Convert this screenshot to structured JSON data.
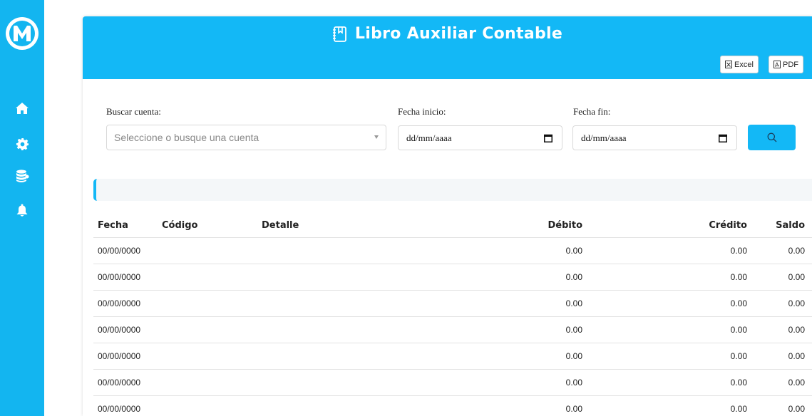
{
  "sidebar": {
    "items": [
      {
        "icon": "home-icon"
      },
      {
        "icon": "gear-icon"
      },
      {
        "icon": "coins-icon"
      },
      {
        "icon": "bell-icon"
      }
    ]
  },
  "header": {
    "title": "Libro Auxiliar Contable",
    "icon": "book-icon",
    "excel_label": "Excel",
    "pdf_label": "PDF"
  },
  "filters": {
    "account_label": "Buscar cuenta:",
    "account_placeholder": "Seleccione o busque una cuenta",
    "start_label": "Fecha inicio:",
    "start_value": "dd/mm/aaaa",
    "end_label": "Fecha fin:",
    "end_value": "dd/mm/aaaa"
  },
  "table": {
    "columns": [
      "Fecha",
      "Código",
      "Detalle",
      "Débito",
      "Crédito",
      "Saldo"
    ],
    "rows": [
      {
        "fecha": "00/00/0000",
        "codigo": "",
        "detalle": "",
        "debito": "0.00",
        "credito": "0.00",
        "saldo": "0.00"
      },
      {
        "fecha": "00/00/0000",
        "codigo": "",
        "detalle": "",
        "debito": "0.00",
        "credito": "0.00",
        "saldo": "0.00"
      },
      {
        "fecha": "00/00/0000",
        "codigo": "",
        "detalle": "",
        "debito": "0.00",
        "credito": "0.00",
        "saldo": "0.00"
      },
      {
        "fecha": "00/00/0000",
        "codigo": "",
        "detalle": "",
        "debito": "0.00",
        "credito": "0.00",
        "saldo": "0.00"
      },
      {
        "fecha": "00/00/0000",
        "codigo": "",
        "detalle": "",
        "debito": "0.00",
        "credito": "0.00",
        "saldo": "0.00"
      },
      {
        "fecha": "00/00/0000",
        "codigo": "",
        "detalle": "",
        "debito": "0.00",
        "credito": "0.00",
        "saldo": "0.00"
      },
      {
        "fecha": "00/00/0000",
        "codigo": "",
        "detalle": "",
        "debito": "0.00",
        "credito": "0.00",
        "saldo": "0.00"
      }
    ]
  },
  "colors": {
    "primary": "#13b8f6",
    "sidebar": "#13b5f0"
  }
}
